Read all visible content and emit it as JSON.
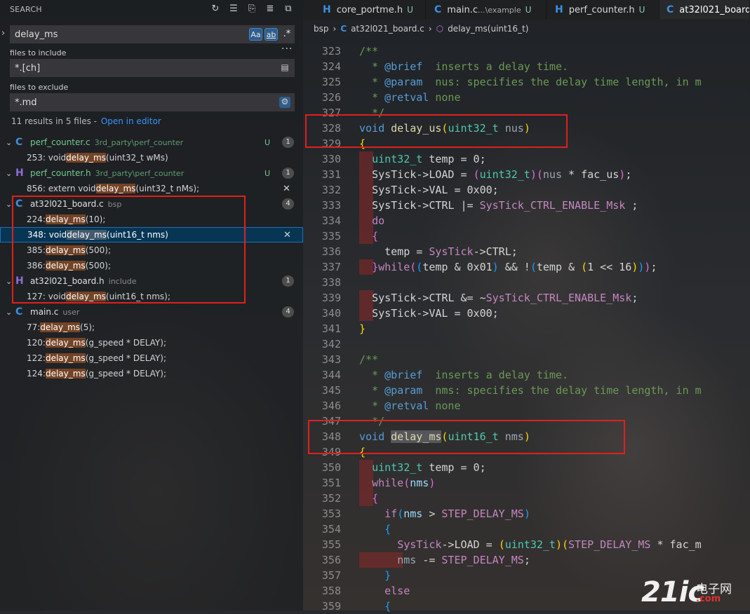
{
  "sidebar": {
    "title": "SEARCH",
    "search_query": "delay_ms",
    "toggle_case": "Aa",
    "toggle_word": "ab",
    "toggle_regex": ".*",
    "include_label": "files to include",
    "include_value": "*.[ch]",
    "exclude_label": "files to exclude",
    "exclude_value": "*.md",
    "summary": "11 results in 5 files -",
    "open_editor": "Open in editor",
    "files": [
      {
        "name": "perf_counter.c",
        "path": "3rd_party\\perf_counter",
        "icon": "C",
        "status": "U",
        "count": "1",
        "matches": [
          {
            "pre": "253: void ",
            "hit": "delay_ms",
            "post": "(uint32_t wMs)"
          }
        ]
      },
      {
        "name": "perf_counter.h",
        "path": "3rd_party\\perf_counter",
        "icon": "H",
        "status": "U",
        "count": "1",
        "matches": [
          {
            "pre": "856: extern void ",
            "hit": "delay_ms",
            "post": "(uint32_t nMs);"
          }
        ]
      },
      {
        "name": "at32l021_board.c",
        "path": "bsp",
        "icon": "C",
        "status": "",
        "count": "4",
        "matches": [
          {
            "pre": "224: ",
            "hit": "delay_ms",
            "post": "(10);"
          },
          {
            "pre": "348: void ",
            "hit": "delay_ms",
            "post": "(uint16_t nms)"
          },
          {
            "pre": "385: ",
            "hit": "delay_ms",
            "post": "(500);"
          },
          {
            "pre": "386: ",
            "hit": "delay_ms",
            "post": "(500);"
          }
        ]
      },
      {
        "name": "at32l021_board.h",
        "path": "include",
        "icon": "H",
        "status": "",
        "count": "1",
        "matches": [
          {
            "pre": "127: void ",
            "hit": "delay_ms",
            "post": "(uint16_t nms);"
          }
        ]
      },
      {
        "name": "main.c",
        "path": "user",
        "icon": "C",
        "status": "",
        "count": "4",
        "matches": [
          {
            "pre": "77: ",
            "hit": "delay_ms",
            "post": "(5);"
          },
          {
            "pre": "120: ",
            "hit": "delay_ms",
            "post": "(g_speed * DELAY);"
          },
          {
            "pre": "122: ",
            "hit": "delay_ms",
            "post": "(g_speed * DELAY);"
          },
          {
            "pre": "124: ",
            "hit": "delay_ms",
            "post": "(g_speed * DELAY);"
          }
        ]
      }
    ]
  },
  "tabs": [
    {
      "icon": "H",
      "label": "core_portme.h",
      "path": "",
      "status": "U"
    },
    {
      "icon": "C",
      "label": "main.c",
      "path": "...\\example",
      "status": "U"
    },
    {
      "icon": "H",
      "label": "perf_counter.h",
      "path": "",
      "status": "U"
    },
    {
      "icon": "C",
      "label": "at32l021_board.c",
      "path": "",
      "status": ""
    }
  ],
  "breadcrumb": {
    "folder": "bsp",
    "file": "at32l021_board.c",
    "symbol": "delay_ms(uint16_t)"
  },
  "code_lines": [
    "323",
    "324",
    "325",
    "326",
    "327",
    "328",
    "329",
    "330",
    "331",
    "332",
    "333",
    "334",
    "335",
    "336",
    "337",
    "338",
    "339",
    "340",
    "341",
    "342",
    "343",
    "344",
    "345",
    "346",
    "347",
    "348",
    "349",
    "350",
    "351",
    "352",
    "353",
    "354",
    "355",
    "356",
    "357",
    "358",
    "359"
  ],
  "code": {
    "l323": "/**",
    "l324a": "  * ",
    "l324b": "@brief",
    "l324c": "  inserts a delay time.",
    "l325a": "  * ",
    "l325b": "@param",
    "l325c": "  nus: specifies the delay time length, in m",
    "l326a": "  * ",
    "l326b": "@retval",
    "l326c": " none",
    "l327": "  */",
    "l328_void": "void",
    "l328_fn": "delay_us",
    "l328_ty": "uint32_t",
    "l328_pa": "nus",
    "l330_ty": "uint32_t",
    "l330_rest": " temp = 0;",
    "l331_a": "SysTick->LOAD = ",
    "l331_ty": "uint32_t",
    "l331_pa": "nus",
    "l331_b": " * fac_us",
    "l332": "SysTick->VAL = 0x00;",
    "l333_a": "SysTick->CTRL |= ",
    "l333_mac": "SysTick_CTRL_ENABLE_Msk",
    "l333_b": " ;",
    "l334": "do",
    "l336_a": "temp = ",
    "l336_mac": "SysTick",
    "l336_b": "->CTRL;",
    "l337_kw": "while",
    "l337_a": "temp & 0x01",
    "l337_b": " && !",
    "l337_c": "temp & ",
    "l337_d": "1 << 16",
    "l339_a": "SysTick->CTRL &= ~",
    "l339_mac": "SysTick_CTRL_ENABLE_Msk",
    "l339_b": ";",
    "l340": "SysTick->VAL = 0x00;",
    "l343": "/**",
    "l344a": "  * ",
    "l344b": "@brief",
    "l344c": "  inserts a delay time.",
    "l345a": "  * ",
    "l345b": "@param",
    "l345c": "  nms: specifies the delay time length, in m",
    "l346a": "  * ",
    "l346b": "@retval",
    "l346c": " none",
    "l347": "  */",
    "l348_void": "void",
    "l348_fn": "delay_ms",
    "l348_ty": "uint16_t",
    "l348_pa": "nms",
    "l350_ty": "uint32_t",
    "l350_rest": " temp = 0;",
    "l351_kw": "while",
    "l351_pa": "nms",
    "l353_kw": "if",
    "l353_pa": "nms",
    "l353_a": " > ",
    "l353_mac": "STEP_DELAY_MS",
    "l355_mac": "SysTick",
    "l355_a": "->LOAD = ",
    "l355_ty": "uint32_t",
    "l355_mac2": "STEP_DELAY_MS",
    "l355_b": " * fac_m",
    "l356_pa": "nms",
    "l356_a": " -= ",
    "l356_mac": "STEP_DELAY_MS",
    "l356_b": ";",
    "l358_kw": "else"
  },
  "watermark": {
    "logo": "21ic",
    "cn": "电子网",
    "com": ".com"
  }
}
